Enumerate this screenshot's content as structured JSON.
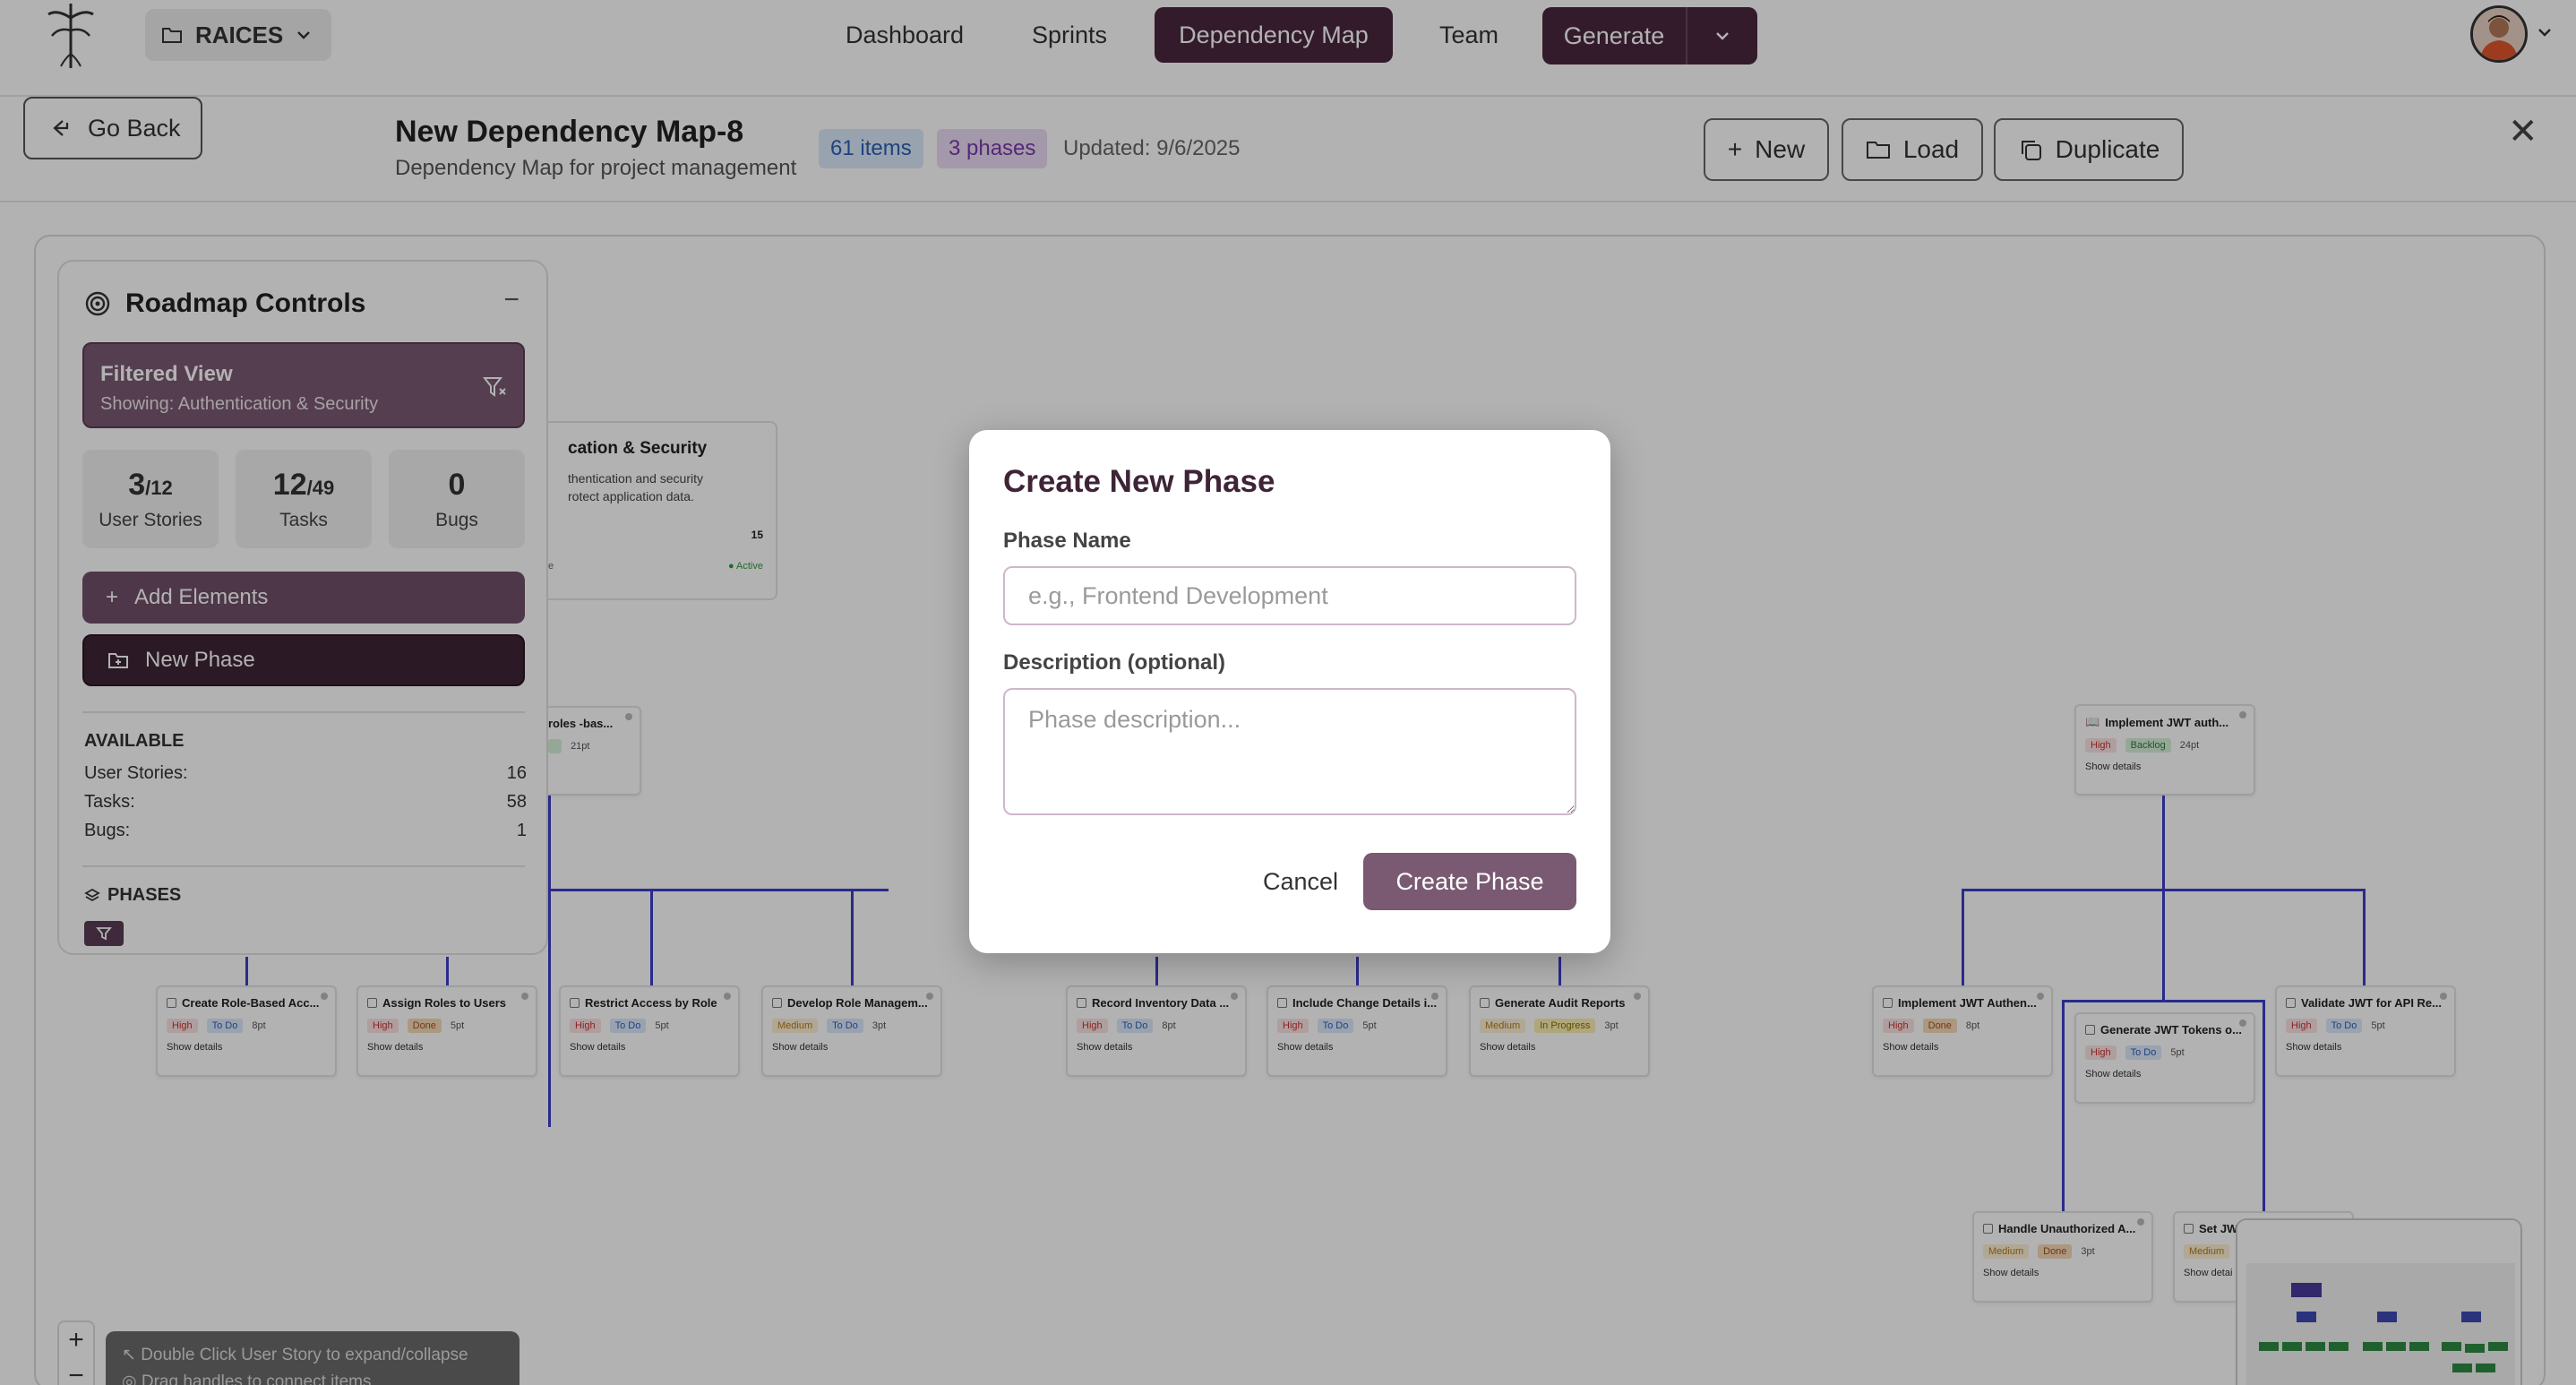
{
  "nav": {
    "project": "RAICES",
    "tabs": [
      {
        "label": "Dashboard"
      },
      {
        "label": "Sprints"
      },
      {
        "label": "Dependency Map"
      },
      {
        "label": "Team"
      }
    ],
    "generate_label": "Generate"
  },
  "header": {
    "back_label": "Go Back",
    "title": "New Dependency Map-8",
    "subtitle": "Dependency Map for project management",
    "items_badge": "61 items",
    "phases_badge": "3 phases",
    "updated": "Updated: 9/6/2025",
    "new_label": "New",
    "load_label": "Load",
    "duplicate_label": "Duplicate"
  },
  "controls": {
    "title": "Roadmap Controls",
    "filter_title": "Filtered View",
    "filter_sub": "Showing: Authentication & Security",
    "stats": [
      {
        "value": "3",
        "total": "/12",
        "label": "User Stories"
      },
      {
        "value": "12",
        "total": "/49",
        "label": "Tasks"
      },
      {
        "value": "0",
        "total": "",
        "label": "Bugs"
      }
    ],
    "add_label": "Add Elements",
    "new_phase_label": "New Phase",
    "available_title": "AVAILABLE",
    "available": [
      {
        "label": "User Stories:",
        "value": "16"
      },
      {
        "label": "Tasks:",
        "value": "58"
      },
      {
        "label": "Bugs:",
        "value": "1"
      }
    ],
    "phases_title": "PHASES"
  },
  "canvas": {
    "phase_card": {
      "title": "cation & Security",
      "desc": "thentication and security\nrotect application data.",
      "count": "15",
      "status": "● Active",
      "left_tag": "e"
    },
    "roles_card": {
      "title": "roles -bas...",
      "pts": "21pt"
    },
    "jwt_card": {
      "title": "Implement JWT auth...",
      "priority": "High",
      "status": "Backlog",
      "pts": "24pt",
      "details": "Show details"
    },
    "cards": [
      {
        "title": "Create Role-Based Acc...",
        "priority": "High",
        "status": "To Do",
        "pts": "8pt",
        "details": "Show details"
      },
      {
        "title": "Assign Roles to Users",
        "priority": "High",
        "status": "Done",
        "pts": "5pt",
        "details": "Show details"
      },
      {
        "title": "Restrict Access by Role",
        "priority": "High",
        "status": "To Do",
        "pts": "5pt",
        "details": "Show details"
      },
      {
        "title": "Develop Role Managem...",
        "priority": "Medium",
        "status": "To Do",
        "pts": "3pt",
        "details": "Show details"
      },
      {
        "title": "Record Inventory Data ...",
        "priority": "High",
        "status": "To Do",
        "pts": "8pt",
        "details": "Show details"
      },
      {
        "title": "Include Change Details i...",
        "priority": "High",
        "status": "To Do",
        "pts": "5pt",
        "details": "Show details"
      },
      {
        "title": "Generate Audit Reports",
        "priority": "Medium",
        "status": "In Progress",
        "pts": "3pt",
        "details": "Show details"
      },
      {
        "title": "Implement JWT Authen...",
        "priority": "High",
        "status": "Done",
        "pts": "8pt",
        "details": "Show details"
      },
      {
        "title": "Generate JWT Tokens o...",
        "priority": "High",
        "status": "To Do",
        "pts": "5pt",
        "details": "Show details"
      },
      {
        "title": "Validate JWT for API Re...",
        "priority": "High",
        "status": "To Do",
        "pts": "5pt",
        "details": "Show details"
      },
      {
        "title": "Handle Unauthorized A...",
        "priority": "Medium",
        "status": "Done",
        "pts": "3pt",
        "details": "Show details"
      },
      {
        "title": "Set JW",
        "priority": "Medium",
        "status": "",
        "pts": "",
        "details": "Show detai"
      }
    ],
    "hint_1": "Double Click User Story to expand/collapse",
    "hint_2": "Drag handles to connect items",
    "zoom_in": "+",
    "zoom_out": "−"
  },
  "modal": {
    "title": "Create New Phase",
    "name_label": "Phase Name",
    "name_placeholder": "e.g., Frontend Development",
    "desc_label": "Description (optional)",
    "desc_placeholder": "Phase description...",
    "cancel_label": "Cancel",
    "create_label": "Create Phase"
  },
  "colors": {
    "brand": "#4a2740",
    "accent": "#7a5a72",
    "connector": "#3d3dc9"
  }
}
